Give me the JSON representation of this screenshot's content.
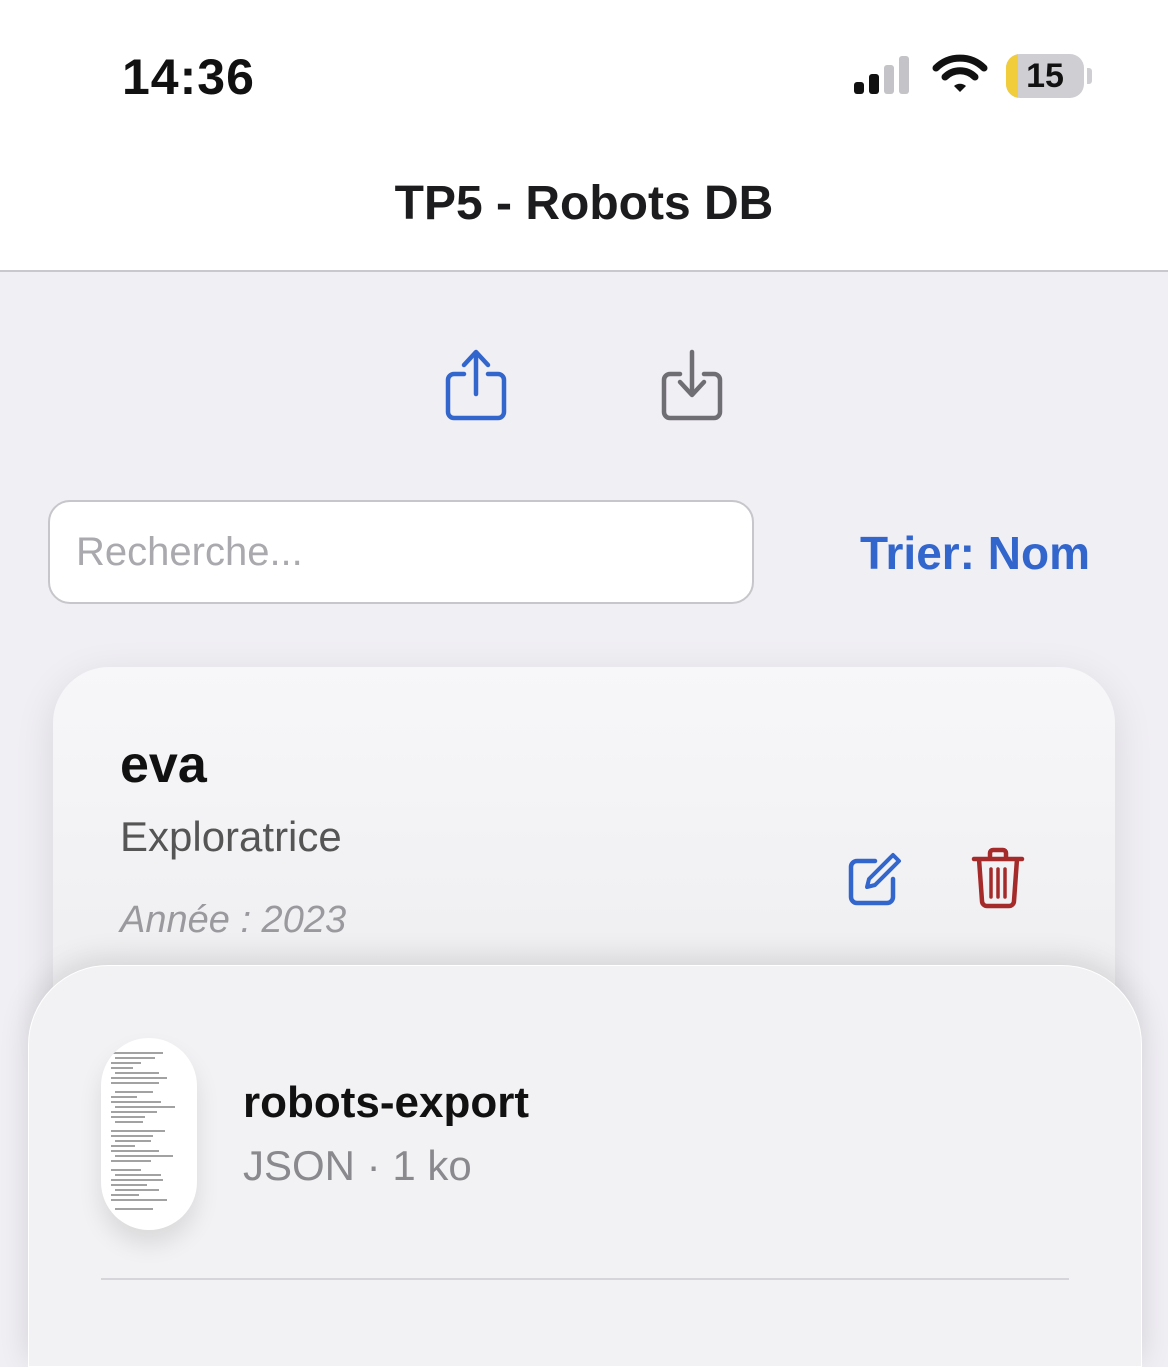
{
  "status_bar": {
    "time": "14:36",
    "battery_level": "15",
    "battery_fraction": 0.15,
    "signal_bars_active": 2,
    "signal_bars_total": 4,
    "icons": [
      "signal-icon",
      "wifi-icon",
      "battery-icon"
    ]
  },
  "header": {
    "title": "TP5 - Robots DB"
  },
  "toolbar": {
    "export_icon": "share-icon",
    "import_icon": "import-icon"
  },
  "search": {
    "placeholder": "Recherche...",
    "value": ""
  },
  "sort": {
    "label": "Trier: Nom"
  },
  "robots": [
    {
      "name": "eva",
      "type": "Exploratrice",
      "year_label": "Année : 2023",
      "edit_icon": "edit-icon",
      "delete_icon": "trash-icon"
    }
  ],
  "share_sheet": {
    "file_name": "robots-export",
    "file_meta": "JSON · 1 ko"
  },
  "colors": {
    "accent": "#3366cc",
    "danger": "#a52a2a",
    "import_icon": "#6e6e73",
    "background": "#f0eff4"
  }
}
